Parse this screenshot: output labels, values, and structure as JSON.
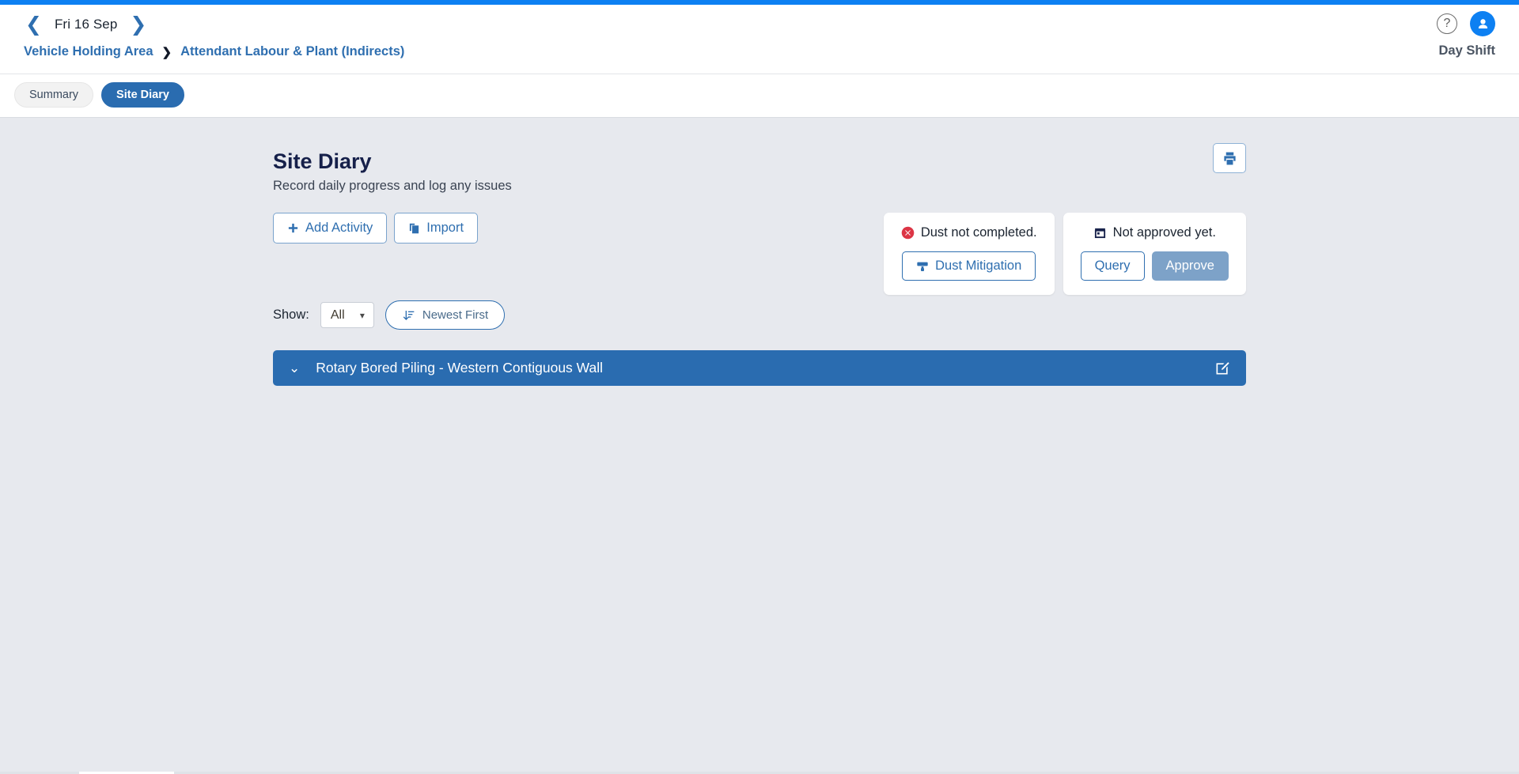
{
  "accent_color": "#0d80f2",
  "primary_color": "#2a6cb0",
  "header": {
    "date": "Fri 16 Sep",
    "prev_icon": "chevron-left-icon",
    "next_icon": "chevron-right-icon",
    "help_icon_label": "?",
    "shift": "Day Shift",
    "breadcrumb": [
      {
        "label": "Vehicle Holding Area"
      },
      {
        "label": "Attendant Labour & Plant (Indirects)"
      }
    ],
    "breadcrumb_separator": "❯"
  },
  "tabs": [
    {
      "label": "Summary",
      "active": false
    },
    {
      "label": "Site Diary",
      "active": true
    }
  ],
  "page": {
    "title": "Site Diary",
    "subtitle": "Record daily progress and log any issues",
    "add_activity_label": "Add Activity",
    "import_label": "Import",
    "print_label": ""
  },
  "cards": {
    "dust": {
      "status_text": "Dust not completed.",
      "status_icon": "error-circle-icon",
      "status_color": "#dc3545",
      "button_label": "Dust Mitigation",
      "button_icon": "paint-roller-icon"
    },
    "approval": {
      "status_text": "Not approved yet.",
      "status_icon": "stamp-icon",
      "query_label": "Query",
      "approve_label": "Approve"
    }
  },
  "filters": {
    "show_label": "Show:",
    "show_value": "All",
    "show_options": [
      "All"
    ],
    "sort_label": "Newest First",
    "sort_icon": "sort-amount-down-icon"
  },
  "activities": [
    {
      "title": "Rotary Bored Piling - Western Contiguous Wall",
      "expanded": true,
      "chevron": "⌄",
      "edit_icon": "pen-square-icon"
    }
  ]
}
